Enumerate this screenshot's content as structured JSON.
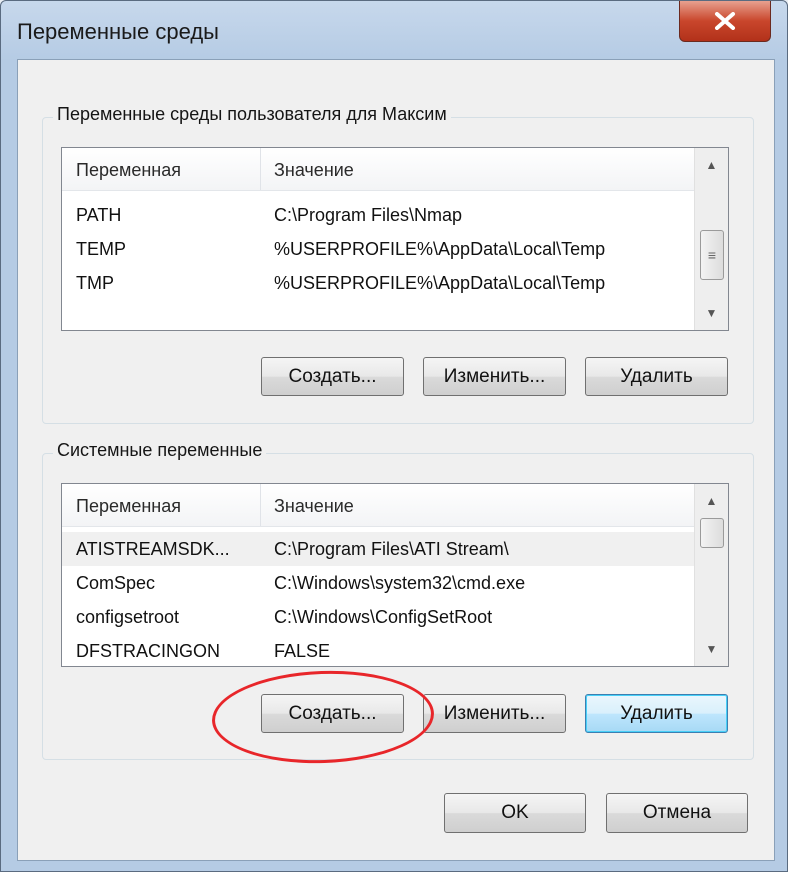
{
  "window": {
    "title": "Переменные среды"
  },
  "user_group": {
    "title": "Переменные среды пользователя для Максим",
    "columns": [
      "Переменная",
      "Значение"
    ],
    "rows": [
      {
        "name": "PATH",
        "value": "C:\\Program Files\\Nmap"
      },
      {
        "name": "TEMP",
        "value": "%USERPROFILE%\\AppData\\Local\\Temp"
      },
      {
        "name": "TMP",
        "value": "%USERPROFILE%\\AppData\\Local\\Temp"
      }
    ],
    "buttons": {
      "create": "Создать...",
      "edit": "Изменить...",
      "delete": "Удалить"
    }
  },
  "system_group": {
    "title": "Системные переменные",
    "columns": [
      "Переменная",
      "Значение"
    ],
    "rows": [
      {
        "name": "ATISTREAMSDK...",
        "value": "C:\\Program Files\\ATI Stream\\"
      },
      {
        "name": "ComSpec",
        "value": "C:\\Windows\\system32\\cmd.exe"
      },
      {
        "name": "configsetroot",
        "value": "C:\\Windows\\ConfigSetRoot"
      },
      {
        "name": "DFSTRACINGON",
        "value": "FALSE"
      }
    ],
    "buttons": {
      "create": "Создать...",
      "edit": "Изменить...",
      "delete": "Удалить"
    }
  },
  "footer": {
    "ok": "OK",
    "cancel": "Отмена"
  },
  "icons": {
    "close": "close-icon",
    "scroll_up": "scroll-up-arrow-icon",
    "scroll_down": "scroll-down-arrow-icon"
  },
  "colors": {
    "annotation": "#e8262a",
    "default_button": "#3c7fb1"
  }
}
